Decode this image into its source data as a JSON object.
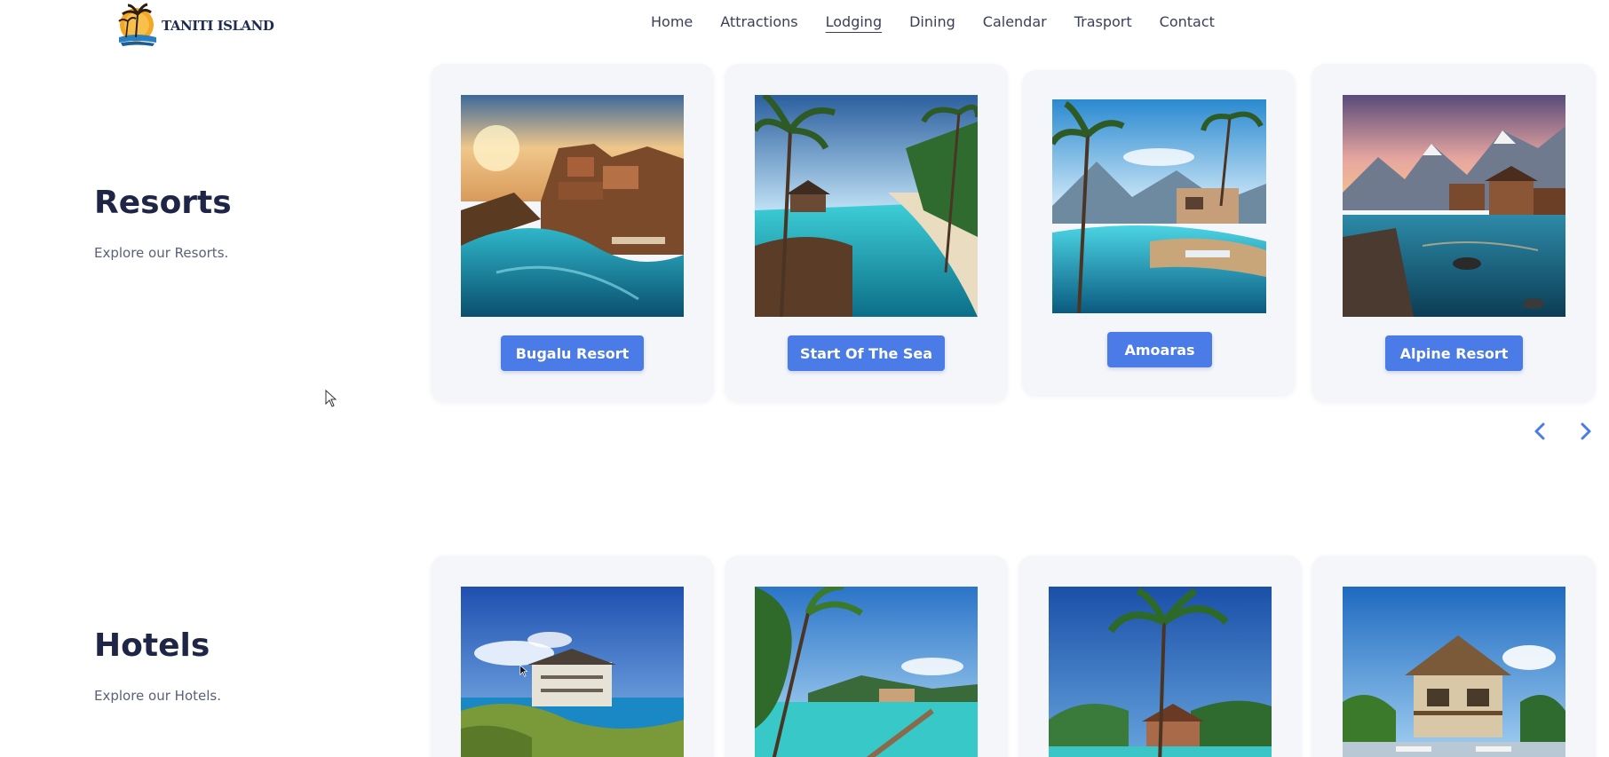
{
  "brand": {
    "name": "TANITI ISLAND",
    "logo_icon": "palm-sunset-logo"
  },
  "nav": [
    {
      "label": "Home",
      "active": false
    },
    {
      "label": "Attractions",
      "active": false
    },
    {
      "label": "Lodging",
      "active": true
    },
    {
      "label": "Dining",
      "active": false
    },
    {
      "label": "Calendar",
      "active": false
    },
    {
      "label": "Trasport",
      "active": false
    },
    {
      "label": "Contact",
      "active": false
    }
  ],
  "resorts": {
    "title": "Resorts",
    "subtitle": "Explore our Resorts.",
    "cards": [
      {
        "label": "Bugalu Resort",
        "image": "resort-pool-sunset"
      },
      {
        "label": "Start Of The Sea",
        "image": "resort-lagoon-palms"
      },
      {
        "label": "Amoaras",
        "image": "resort-pool-mountains"
      },
      {
        "label": "Alpine Resort",
        "image": "alpine-lake-village"
      }
    ],
    "prev_icon": "chevron-left-icon",
    "next_icon": "chevron-right-icon"
  },
  "hotels": {
    "title": "Hotels",
    "subtitle": "Explore our Hotels.",
    "cards": [
      {
        "image": "hotel-cliff-ocean"
      },
      {
        "image": "hotel-pier-palms"
      },
      {
        "image": "hotel-palm-beach"
      },
      {
        "image": "hotel-thatched-villa"
      }
    ]
  },
  "colors": {
    "accent": "#4a7be6",
    "heading": "#1f2547",
    "card_bg": "#f4f6fa"
  }
}
